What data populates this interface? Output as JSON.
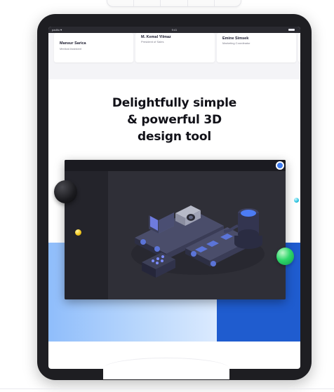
{
  "status_bar": {
    "carrier": "paditu ♥",
    "time": "9:41"
  },
  "testimonials": [
    {
      "name": "Mansur Sarica",
      "role": "Medical Assistant"
    },
    {
      "name": "M. Kemal Yilmaz",
      "role": "President of Sales"
    },
    {
      "name": "Emine Simsek",
      "role": "Marketing Coordinator"
    }
  ],
  "hero": {
    "title_line_1": "Delightfully simple",
    "title_line_2": "& powerful 3D",
    "title_line_3": "design tool"
  },
  "mockup": {
    "illustration": "isometric-3d-factory-illustration",
    "toggle_icon": "radio-toggle-icon"
  },
  "colors": {
    "frame": "#1e1e22",
    "accent_blue": "#1f5ccf",
    "light_blue": "#8fbdfb",
    "mockup_bg": "#2c2c34",
    "green_ball": "#2ed86a",
    "yellow_ball": "#f2c81f",
    "teal_ball": "#2fc4e0"
  }
}
